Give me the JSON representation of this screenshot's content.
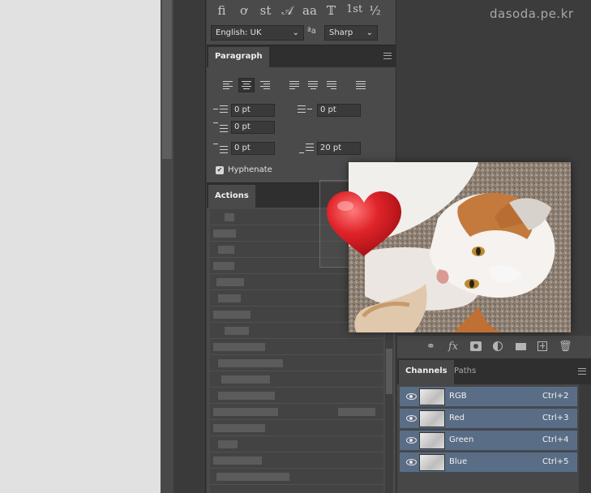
{
  "character": {
    "glyphs": [
      "fi",
      "ơ",
      "st",
      "𝒜",
      "aa",
      "𝕋",
      "1st",
      "½"
    ],
    "language": "English: UK",
    "antialias": "Sharp",
    "aa_icon": "ªa"
  },
  "paragraph": {
    "tab_label": "Paragraph",
    "indent_left": "0 pt",
    "indent_right": "0 pt",
    "indent_first": "0 pt",
    "space_before": "0 pt",
    "space_after": "20 pt",
    "hyphenate_label": "Hyphenate",
    "hyphenate_checked": true,
    "check_mark": "✔"
  },
  "actions": {
    "tab_label": "Actions"
  },
  "watermark": "dasoda.pe.kr",
  "layer_toolbar": {
    "fx_label": "fx"
  },
  "channels": {
    "tabs": [
      {
        "label": "Channels"
      },
      {
        "label": "Paths"
      }
    ],
    "rows": [
      {
        "name": "RGB",
        "shortcut": "Ctrl+2"
      },
      {
        "name": "Red",
        "shortcut": "Ctrl+3"
      },
      {
        "name": "Green",
        "shortcut": "Ctrl+4"
      },
      {
        "name": "Blue",
        "shortcut": "Ctrl+5"
      }
    ]
  },
  "colors": {
    "panel_bg": "#4a4a4a",
    "selected_row": "#5a6d86",
    "heart_red": "#e0242a",
    "canvas_bg": "#e1e1e1"
  },
  "icons": [
    "link-icon",
    "fx-icon",
    "mask-icon",
    "adjustment-icon",
    "folder-icon",
    "new-channel-icon",
    "trash-icon",
    "eye-icon",
    "menu-icon",
    "checkbox-icon"
  ]
}
